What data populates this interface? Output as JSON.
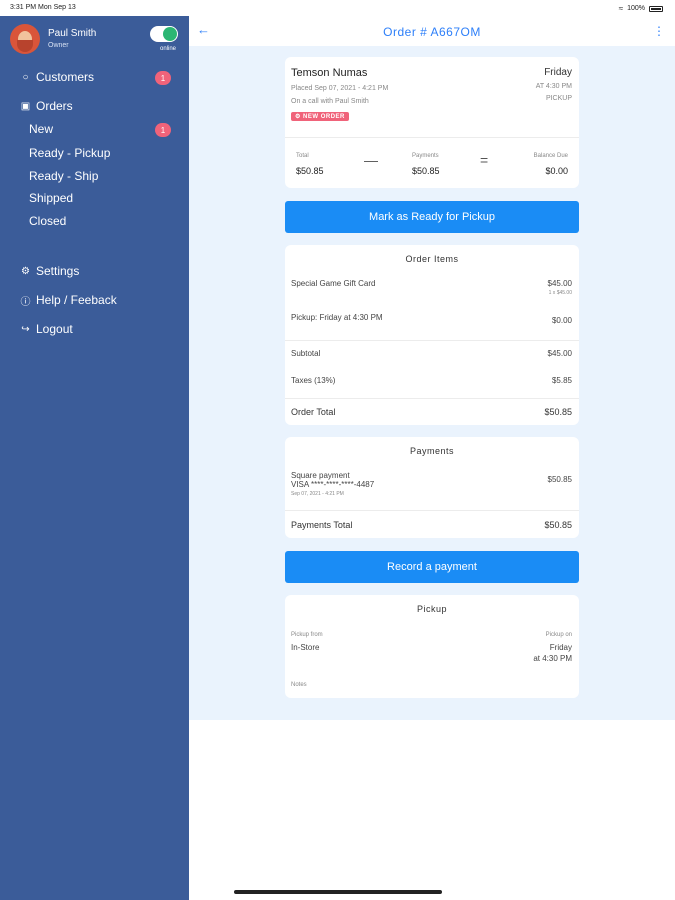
{
  "status_bar": {
    "time": "3:31 PM  Mon Sep 13",
    "battery": "100%"
  },
  "profile": {
    "name": "Paul Smith",
    "role": "Owner",
    "status": "online"
  },
  "nav": {
    "customers": {
      "label": "Customers",
      "badge": "1"
    },
    "orders": {
      "label": "Orders"
    },
    "orders_sub": [
      {
        "label": "New",
        "badge": "1"
      },
      {
        "label": "Ready - Pickup"
      },
      {
        "label": "Ready - Ship"
      },
      {
        "label": "Shipped"
      },
      {
        "label": "Closed"
      }
    ],
    "settings": "Settings",
    "help": "Help / Feeback",
    "logout": "Logout"
  },
  "header": {
    "title": "Order # A667OM"
  },
  "summary": {
    "customer": "Temson Numas",
    "placed": "Placed Sep 07, 2021 - 4:21 PM",
    "note": "On a call with Paul Smith",
    "status_badge": "NEW ORDER",
    "day": "Friday",
    "time": "AT 4:30 PM",
    "method": "PICKUP",
    "total_label": "Total",
    "total_value": "$50.85",
    "payments_label": "Payments",
    "payments_value": "$50.85",
    "balance_label": "Balance Due",
    "balance_value": "$0.00",
    "minus": "—",
    "equals": "="
  },
  "actions": {
    "ready": "Mark as Ready for Pickup",
    "record": "Record a payment"
  },
  "order_items": {
    "title": "Order Items",
    "item1_name": "Special Game Gift Card",
    "item1_price": "$45.00",
    "item1_qty": "1 x $45.00",
    "item2_name": "Pickup: Friday at 4:30 PM",
    "item2_price": "$0.00",
    "subtotal_label": "Subtotal",
    "subtotal_value": "$45.00",
    "taxes_label": "Taxes (13%)",
    "taxes_value": "$5.85",
    "total_label": "Order Total",
    "total_value": "$50.85"
  },
  "payments": {
    "title": "Payments",
    "method": "Square payment",
    "card": "VISA ****-****-****-4487",
    "date": "Sep 07, 2021 - 4:21 PM",
    "amount": "$50.85",
    "total_label": "Payments Total",
    "total_value": "$50.85"
  },
  "pickup": {
    "title": "Pickup",
    "from_label": "Pickup from",
    "from_value": "In-Store",
    "on_label": "Pickup on",
    "on_day": "Friday",
    "on_time": "at 4:30 PM",
    "notes_label": "Notes"
  },
  "colors": {
    "sidebar": "#3b5c99",
    "accent": "#1a8cf5",
    "badge": "#f0637a",
    "online": "#2bb673",
    "background": "#eaf3fd"
  }
}
